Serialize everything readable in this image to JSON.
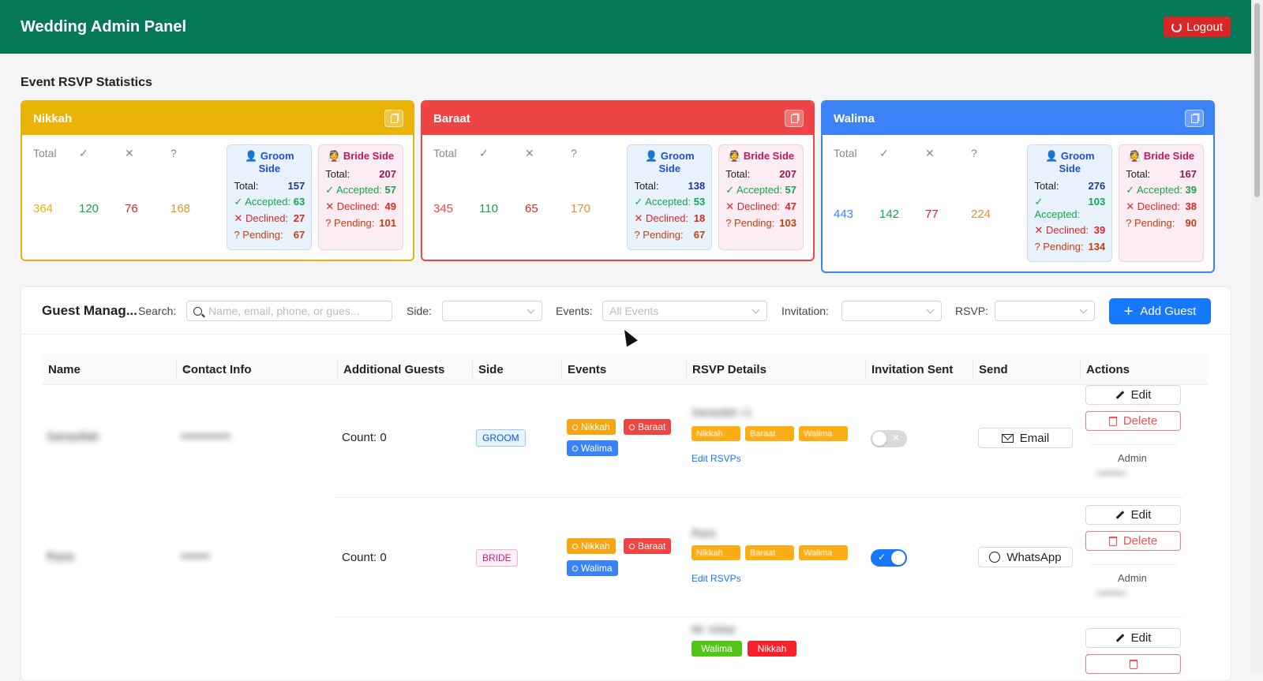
{
  "header": {
    "title": "Wedding Admin Panel",
    "logout_label": "Logout"
  },
  "stats": {
    "title": "Event RSVP Statistics",
    "labels": {
      "total": "Total",
      "accepted": "✓",
      "declined": "✕",
      "pending": "?"
    },
    "side_labels": {
      "groom": "👤 Groom Side",
      "bride": "👰 Bride Side",
      "total": "Total:",
      "accepted": "✓ Accepted:",
      "declined": "✕ Declined:",
      "pending": "? Pending:"
    },
    "events": [
      {
        "name": "Nikkah",
        "color": "#eab308",
        "total": "364",
        "accepted": "120",
        "declined": "76",
        "pending": "168",
        "groom": {
          "total": "157",
          "accepted": "63",
          "declined": "27",
          "pending": "67"
        },
        "bride": {
          "total": "207",
          "accepted": "57",
          "declined": "49",
          "pending": "101"
        }
      },
      {
        "name": "Baraat",
        "color": "#ef4444",
        "total": "345",
        "accepted": "110",
        "declined": "65",
        "pending": "170",
        "groom": {
          "total": "138",
          "accepted": "53",
          "declined": "18",
          "pending": "67"
        },
        "bride": {
          "total": "207",
          "accepted": "57",
          "declined": "47",
          "pending": "103"
        }
      },
      {
        "name": "Walima",
        "color": "#3b82f6",
        "total": "443",
        "accepted": "142",
        "declined": "77",
        "pending": "224",
        "groom": {
          "total": "276",
          "accepted": "103",
          "declined": "39",
          "pending": "134"
        },
        "bride": {
          "total": "167",
          "accepted": "39",
          "declined": "38",
          "pending": "90"
        }
      }
    ]
  },
  "guests": {
    "title": "Guest Manag...",
    "search_label": "Search:",
    "search_placeholder": "Name, email, phone, or gues...",
    "side_label": "Side:",
    "events_label": "Events:",
    "events_value": "All Events",
    "invitation_label": "Invitation:",
    "rsvp_label": "RSVP:",
    "add_label": "Add Guest",
    "columns": [
      "Name",
      "Contact Info",
      "Additional Guests",
      "Side",
      "Events",
      "RSVP Details",
      "Invitation Sent",
      "Send",
      "Actions"
    ],
    "edit_label": "Edit",
    "delete_label": "Delete",
    "edit_rsvps_label": "Edit RSVPs",
    "rows": [
      {
        "name": "Sanaullah",
        "contact": "••••••••••••",
        "count": "Count: 0",
        "side": "GROOM",
        "events": [
          "Nikkah",
          "Baraat",
          "Walima"
        ],
        "rsvp_name": "Sanaullah +1",
        "rsvp_chips": [
          "Nikkah",
          "Baraat",
          "Walima"
        ],
        "invited": false,
        "send": "Email",
        "created_by": "Admin",
        "created_at": "••••••••"
      },
      {
        "name": "Raza",
        "contact": "•••••••",
        "count": "Count: 0",
        "side": "BRIDE",
        "events": [
          "Nikkah",
          "Baraat",
          "Walima"
        ],
        "rsvp_name": "Raza",
        "rsvp_chips": [
          "Nikkah",
          "Baraat",
          "Walima"
        ],
        "invited": true,
        "send": "WhatsApp",
        "created_by": "Admin",
        "created_at": "••••••••"
      },
      {
        "rsvp_name": "Mr. Imtiaz",
        "rsvp_chips": [
          "Walima",
          "Nikkah"
        ]
      }
    ]
  }
}
